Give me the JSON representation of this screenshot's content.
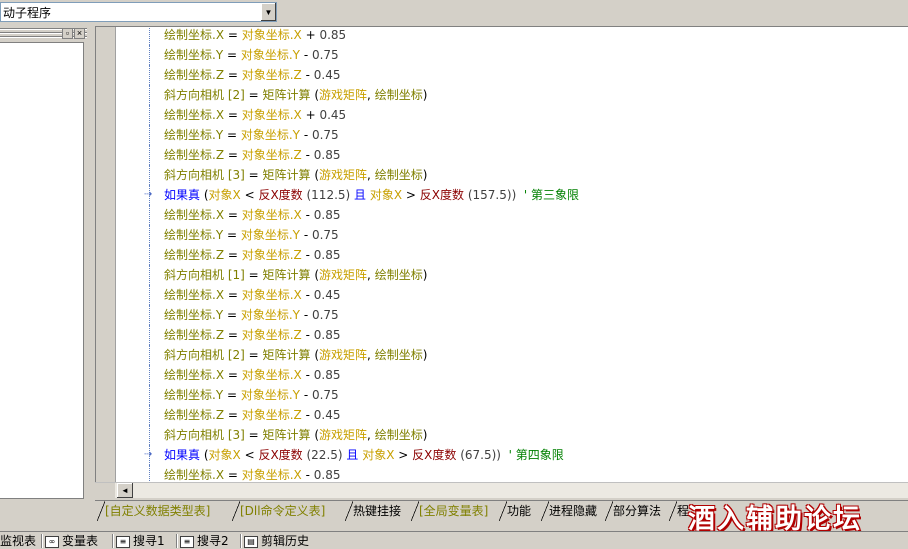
{
  "combo": {
    "value": "动子程序",
    "arrow": "▼"
  },
  "panel": {
    "restore_glyph": "▫",
    "close_glyph": "×"
  },
  "colors": {
    "var": "#c8a000",
    "fn": "#808000",
    "num": "#404040",
    "op": "#000000",
    "kw": "#0000ff",
    "cmt": "#008000",
    "callfn": "#8b0000"
  },
  "code_lines": [
    {
      "indent": 1,
      "tokens": [
        {
          "t": "绘制坐标.X",
          "c": "fn"
        },
        {
          "t": " = ",
          "c": "op"
        },
        {
          "t": "对象坐标.X",
          "c": "var"
        },
        {
          "t": " + ",
          "c": "op"
        },
        {
          "t": "0.85",
          "c": "num"
        }
      ]
    },
    {
      "indent": 1,
      "tokens": [
        {
          "t": "绘制坐标.Y",
          "c": "fn"
        },
        {
          "t": " = ",
          "c": "op"
        },
        {
          "t": "对象坐标.Y",
          "c": "var"
        },
        {
          "t": " - ",
          "c": "op"
        },
        {
          "t": "0.75",
          "c": "num"
        }
      ]
    },
    {
      "indent": 1,
      "tokens": [
        {
          "t": "绘制坐标.Z",
          "c": "fn"
        },
        {
          "t": " = ",
          "c": "op"
        },
        {
          "t": "对象坐标.Z",
          "c": "var"
        },
        {
          "t": " - ",
          "c": "op"
        },
        {
          "t": "0.45",
          "c": "num"
        }
      ]
    },
    {
      "indent": 1,
      "tokens": [
        {
          "t": "斜方向相机 [2]",
          "c": "fn"
        },
        {
          "t": " = ",
          "c": "op"
        },
        {
          "t": "矩阵计算",
          "c": "fn"
        },
        {
          "t": " (",
          "c": "op"
        },
        {
          "t": "游戏矩阵",
          "c": "var"
        },
        {
          "t": ", ",
          "c": "op"
        },
        {
          "t": "绘制坐标",
          "c": "fn"
        },
        {
          "t": ")",
          "c": "op"
        }
      ]
    },
    {
      "indent": 1,
      "tokens": [
        {
          "t": "绘制坐标.X",
          "c": "fn"
        },
        {
          "t": " = ",
          "c": "op"
        },
        {
          "t": "对象坐标.X",
          "c": "var"
        },
        {
          "t": " + ",
          "c": "op"
        },
        {
          "t": "0.45",
          "c": "num"
        }
      ]
    },
    {
      "indent": 1,
      "tokens": [
        {
          "t": "绘制坐标.Y",
          "c": "fn"
        },
        {
          "t": " = ",
          "c": "op"
        },
        {
          "t": "对象坐标.Y",
          "c": "var"
        },
        {
          "t": " - ",
          "c": "op"
        },
        {
          "t": "0.75",
          "c": "num"
        }
      ]
    },
    {
      "indent": 1,
      "tokens": [
        {
          "t": "绘制坐标.Z",
          "c": "fn"
        },
        {
          "t": " = ",
          "c": "op"
        },
        {
          "t": "对象坐标.Z",
          "c": "var"
        },
        {
          "t": " - ",
          "c": "op"
        },
        {
          "t": "0.85",
          "c": "num"
        }
      ]
    },
    {
      "indent": 1,
      "tokens": [
        {
          "t": "斜方向相机 [3]",
          "c": "fn"
        },
        {
          "t": " = ",
          "c": "op"
        },
        {
          "t": "矩阵计算",
          "c": "fn"
        },
        {
          "t": " (",
          "c": "op"
        },
        {
          "t": "游戏矩阵",
          "c": "var"
        },
        {
          "t": ", ",
          "c": "op"
        },
        {
          "t": "绘制坐标",
          "c": "fn"
        },
        {
          "t": ")",
          "c": "op"
        }
      ]
    },
    {
      "indent": 1,
      "arrow": true,
      "tokens": [
        {
          "t": "如果真",
          "c": "kw"
        },
        {
          "t": " (",
          "c": "op"
        },
        {
          "t": "对象X",
          "c": "var"
        },
        {
          "t": " < ",
          "c": "op"
        },
        {
          "t": "反X度数",
          "c": "callfn"
        },
        {
          "t": " (112.5) ",
          "c": "num"
        },
        {
          "t": "且",
          "c": "kw"
        },
        {
          "t": " ",
          "c": "op"
        },
        {
          "t": "对象X",
          "c": "var"
        },
        {
          "t": " > ",
          "c": "op"
        },
        {
          "t": "反X度数",
          "c": "callfn"
        },
        {
          "t": " (157.5)) ",
          "c": "num"
        },
        {
          "t": " ' 第三象限",
          "c": "cmt"
        }
      ]
    },
    {
      "indent": 1,
      "tokens": [
        {
          "t": "绘制坐标.X",
          "c": "fn"
        },
        {
          "t": " = ",
          "c": "op"
        },
        {
          "t": "对象坐标.X",
          "c": "var"
        },
        {
          "t": " - ",
          "c": "op"
        },
        {
          "t": "0.85",
          "c": "num"
        }
      ]
    },
    {
      "indent": 1,
      "tokens": [
        {
          "t": "绘制坐标.Y",
          "c": "fn"
        },
        {
          "t": " = ",
          "c": "op"
        },
        {
          "t": "对象坐标.Y",
          "c": "var"
        },
        {
          "t": " - ",
          "c": "op"
        },
        {
          "t": "0.75",
          "c": "num"
        }
      ]
    },
    {
      "indent": 1,
      "tokens": [
        {
          "t": "绘制坐标.Z",
          "c": "fn"
        },
        {
          "t": " = ",
          "c": "op"
        },
        {
          "t": "对象坐标.Z",
          "c": "var"
        },
        {
          "t": " - ",
          "c": "op"
        },
        {
          "t": "0.85",
          "c": "num"
        }
      ]
    },
    {
      "indent": 1,
      "tokens": [
        {
          "t": "斜方向相机 [1]",
          "c": "fn"
        },
        {
          "t": " = ",
          "c": "op"
        },
        {
          "t": "矩阵计算",
          "c": "fn"
        },
        {
          "t": " (",
          "c": "op"
        },
        {
          "t": "游戏矩阵",
          "c": "var"
        },
        {
          "t": ", ",
          "c": "op"
        },
        {
          "t": "绘制坐标",
          "c": "fn"
        },
        {
          "t": ")",
          "c": "op"
        }
      ]
    },
    {
      "indent": 1,
      "tokens": [
        {
          "t": "绘制坐标.X",
          "c": "fn"
        },
        {
          "t": " = ",
          "c": "op"
        },
        {
          "t": "对象坐标.X",
          "c": "var"
        },
        {
          "t": " - ",
          "c": "op"
        },
        {
          "t": "0.45",
          "c": "num"
        }
      ]
    },
    {
      "indent": 1,
      "tokens": [
        {
          "t": "绘制坐标.Y",
          "c": "fn"
        },
        {
          "t": " = ",
          "c": "op"
        },
        {
          "t": "对象坐标.Y",
          "c": "var"
        },
        {
          "t": " - ",
          "c": "op"
        },
        {
          "t": "0.75",
          "c": "num"
        }
      ]
    },
    {
      "indent": 1,
      "tokens": [
        {
          "t": "绘制坐标.Z",
          "c": "fn"
        },
        {
          "t": " = ",
          "c": "op"
        },
        {
          "t": "对象坐标.Z",
          "c": "var"
        },
        {
          "t": " - ",
          "c": "op"
        },
        {
          "t": "0.85",
          "c": "num"
        }
      ]
    },
    {
      "indent": 1,
      "tokens": [
        {
          "t": "斜方向相机 [2]",
          "c": "fn"
        },
        {
          "t": " = ",
          "c": "op"
        },
        {
          "t": "矩阵计算",
          "c": "fn"
        },
        {
          "t": " (",
          "c": "op"
        },
        {
          "t": "游戏矩阵",
          "c": "var"
        },
        {
          "t": ", ",
          "c": "op"
        },
        {
          "t": "绘制坐标",
          "c": "fn"
        },
        {
          "t": ")",
          "c": "op"
        }
      ]
    },
    {
      "indent": 1,
      "tokens": [
        {
          "t": "绘制坐标.X",
          "c": "fn"
        },
        {
          "t": " = ",
          "c": "op"
        },
        {
          "t": "对象坐标.X",
          "c": "var"
        },
        {
          "t": " - ",
          "c": "op"
        },
        {
          "t": "0.85",
          "c": "num"
        }
      ]
    },
    {
      "indent": 1,
      "tokens": [
        {
          "t": "绘制坐标.Y",
          "c": "fn"
        },
        {
          "t": " = ",
          "c": "op"
        },
        {
          "t": "对象坐标.Y",
          "c": "var"
        },
        {
          "t": " - ",
          "c": "op"
        },
        {
          "t": "0.75",
          "c": "num"
        }
      ]
    },
    {
      "indent": 1,
      "tokens": [
        {
          "t": "绘制坐标.Z",
          "c": "fn"
        },
        {
          "t": " = ",
          "c": "op"
        },
        {
          "t": "对象坐标.Z",
          "c": "var"
        },
        {
          "t": " - ",
          "c": "op"
        },
        {
          "t": "0.45",
          "c": "num"
        }
      ]
    },
    {
      "indent": 1,
      "tokens": [
        {
          "t": "斜方向相机 [3]",
          "c": "fn"
        },
        {
          "t": " = ",
          "c": "op"
        },
        {
          "t": "矩阵计算",
          "c": "fn"
        },
        {
          "t": " (",
          "c": "op"
        },
        {
          "t": "游戏矩阵",
          "c": "var"
        },
        {
          "t": ", ",
          "c": "op"
        },
        {
          "t": "绘制坐标",
          "c": "fn"
        },
        {
          "t": ")",
          "c": "op"
        }
      ]
    },
    {
      "indent": 1,
      "arrow": true,
      "tokens": [
        {
          "t": "如果真",
          "c": "kw"
        },
        {
          "t": " (",
          "c": "op"
        },
        {
          "t": "对象X",
          "c": "var"
        },
        {
          "t": " < ",
          "c": "op"
        },
        {
          "t": "反X度数",
          "c": "callfn"
        },
        {
          "t": " (22.5) ",
          "c": "num"
        },
        {
          "t": "且",
          "c": "kw"
        },
        {
          "t": " ",
          "c": "op"
        },
        {
          "t": "对象X",
          "c": "var"
        },
        {
          "t": " > ",
          "c": "op"
        },
        {
          "t": "反X度数",
          "c": "callfn"
        },
        {
          "t": " (67.5)) ",
          "c": "num"
        },
        {
          "t": " ' 第四象限",
          "c": "cmt"
        }
      ]
    },
    {
      "indent": 1,
      "tokens": [
        {
          "t": "绘制坐标.X",
          "c": "fn"
        },
        {
          "t": " = ",
          "c": "op"
        },
        {
          "t": "对象坐标.X",
          "c": "var"
        },
        {
          "t": " - ",
          "c": "op"
        },
        {
          "t": "0.85",
          "c": "num"
        }
      ]
    }
  ],
  "hscroll": {
    "left_arrow": "◄"
  },
  "tabs": [
    {
      "label": "[自定义数据类型表]",
      "color": "#808000"
    },
    {
      "label": "[Dll命令定义表]",
      "color": "#808000"
    },
    {
      "label": "热键挂接",
      "color": "#000000"
    },
    {
      "label": "[全局变量表]",
      "color": "#808000"
    },
    {
      "label": "功能",
      "color": "#000000"
    },
    {
      "label": "进程隐藏",
      "color": "#000000"
    },
    {
      "label": "部分算法",
      "color": "#000000"
    },
    {
      "label": "程",
      "color": "#000000"
    }
  ],
  "watermark": "酒入辅助论坛",
  "status_tabs": [
    {
      "label": "监视表",
      "icon": ""
    },
    {
      "label": "变量表",
      "icon": "∞"
    },
    {
      "label": "搜寻1",
      "icon": "≡"
    },
    {
      "label": "搜寻2",
      "icon": "≡"
    },
    {
      "label": "剪辑历史",
      "icon": "▤"
    }
  ]
}
